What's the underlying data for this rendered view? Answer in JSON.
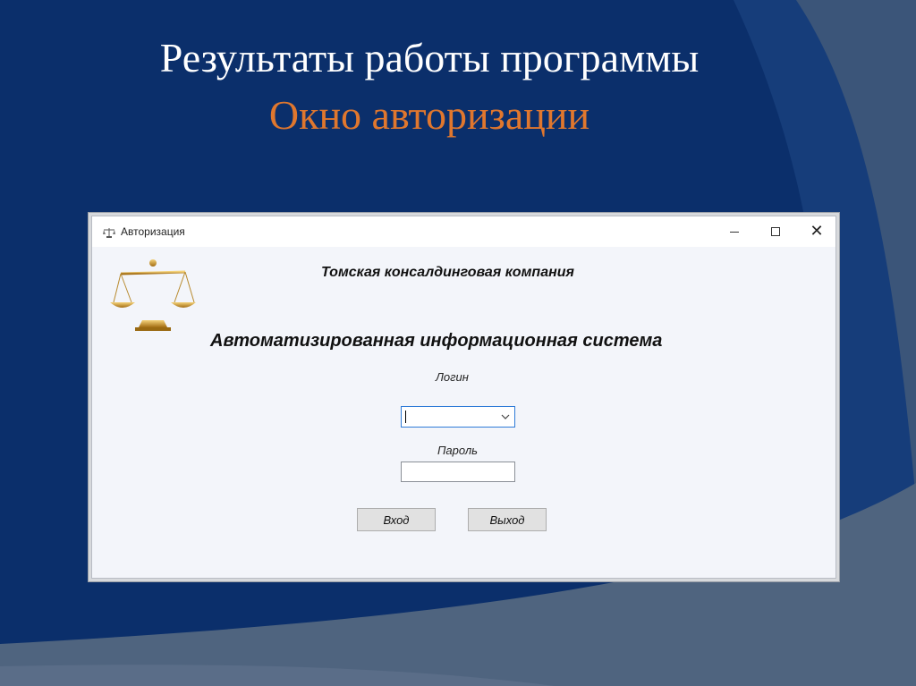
{
  "slide": {
    "title": "Результаты работы программы",
    "subtitle": "Окно авторизации",
    "colors": {
      "background": "#0b2f6b",
      "title": "#ffffff",
      "subtitle": "#e0772e"
    }
  },
  "window": {
    "title": "Авторизация",
    "icon": "scales-icon",
    "controls": {
      "minimize": "minimize-icon",
      "maximize": "maximize-icon",
      "close": "close-icon"
    }
  },
  "content": {
    "logo": "scales-of-justice-icon",
    "company_name": "Томская консалдинговая компания",
    "system_name": "Автоматизированная информационная система",
    "login": {
      "label": "Логин",
      "value": ""
    },
    "password": {
      "label": "Пароль",
      "value": ""
    },
    "buttons": {
      "enter": "Вход",
      "exit": "Выход"
    }
  }
}
